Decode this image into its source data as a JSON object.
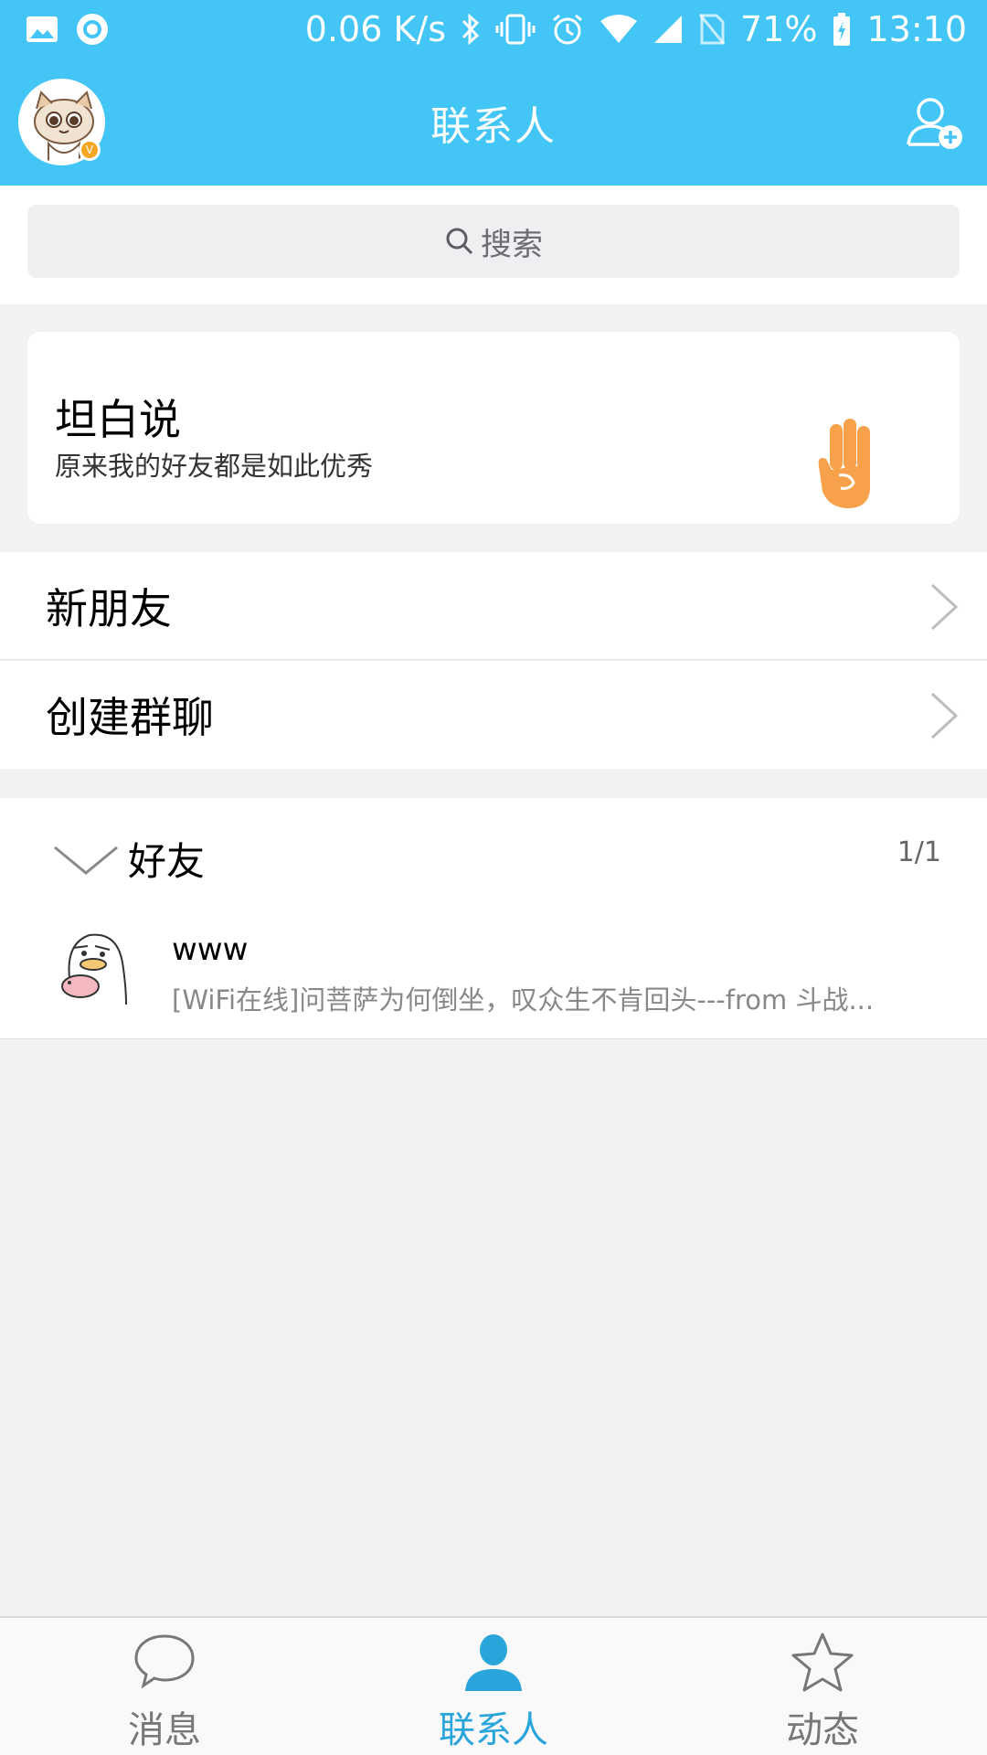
{
  "status_bar": {
    "network_speed": "0.06 K/s",
    "battery": "71%",
    "time": "13:10",
    "icons": [
      "image-icon",
      "circle-app-icon",
      "bluetooth-icon",
      "vibrate-icon",
      "alarm-icon",
      "wifi-icon",
      "signal-icon",
      "no-sim-icon",
      "battery-charging-icon"
    ]
  },
  "header": {
    "title": "联系人",
    "avatar_badge": "V",
    "add_icon": "add-contact-icon"
  },
  "search": {
    "placeholder": "搜索",
    "icon": "search-icon"
  },
  "candid": {
    "title": "坦白说",
    "subtitle": "原来我的好友都是如此优秀",
    "icon": "hand-icon",
    "icon_color": "#f7a14a"
  },
  "menu": {
    "new_friends": "新朋友",
    "create_group": "创建群聊"
  },
  "friends_group": {
    "label": "好友",
    "count": "1/1",
    "friends": [
      {
        "name": "www",
        "status": "[WiFi在线]问菩萨为何倒坐，叹众生不肯回头---from 斗战..."
      }
    ]
  },
  "tabs": [
    {
      "label": "消息",
      "icon": "chat-bubble-icon",
      "active": false
    },
    {
      "label": "联系人",
      "icon": "person-icon",
      "active": true
    },
    {
      "label": "动态",
      "icon": "star-icon",
      "active": false
    }
  ],
  "colors": {
    "brand": "#43c5f5",
    "active_tab": "#2aa5dc"
  }
}
